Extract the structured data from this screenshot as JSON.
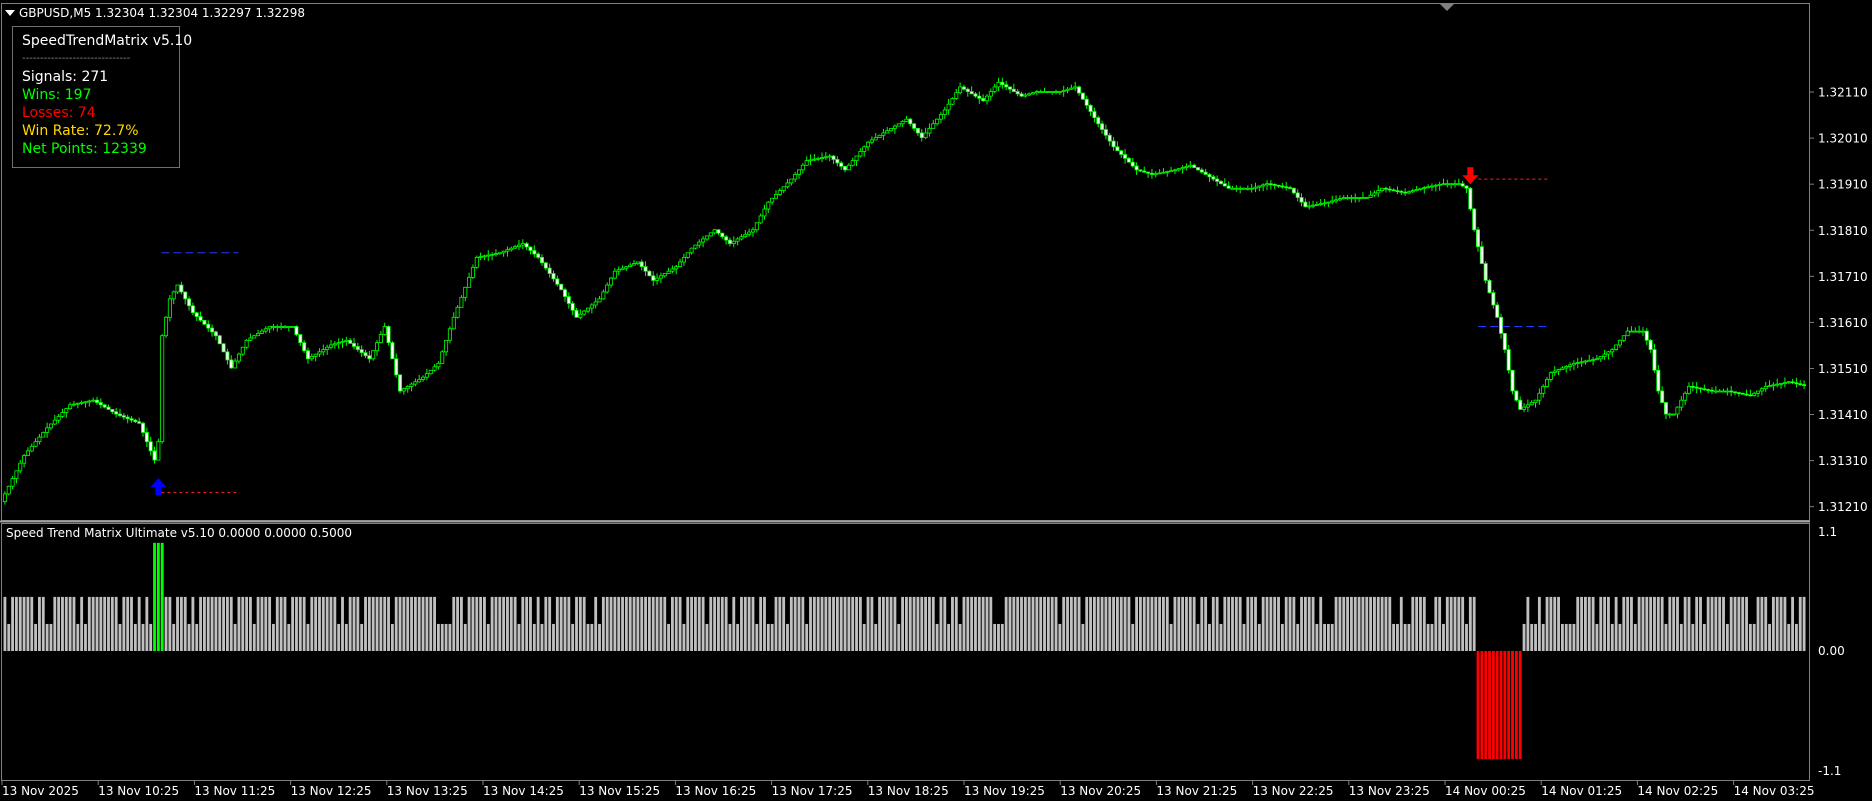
{
  "window": {
    "title": "GBPUSD,M5  1.32304 1.32304 1.32297 1.32298"
  },
  "stats_panel": {
    "title": "SpeedTrendMatrix v5.10",
    "separator": "------------------------------",
    "signals": "Signals: 271",
    "wins": "Wins: 197",
    "losses": "Losses: 74",
    "win_rate": "Win Rate: 72.7%",
    "net_points": "Net Points: 12339",
    "colors": {
      "text": "#ffffff",
      "wins": "#00ff00",
      "losses": "#ff0000",
      "win_rate": "#ffd700",
      "net_points": "#00ff00"
    }
  },
  "indicator_panel": {
    "title": "Speed Trend Matrix Ultimate v5.10 0.0000 0.0000 0.5000",
    "y_ticks": [
      "1.1",
      "0.00",
      "-1.1"
    ],
    "colors": {
      "neutral": "#c0c0c0",
      "bull": "#00ff00",
      "bear": "#ff0000"
    }
  },
  "price_axis": {
    "ticks": [
      "1.32110",
      "1.32010",
      "1.31910",
      "1.31810",
      "1.31710",
      "1.31610",
      "1.31510",
      "1.31410",
      "1.31310",
      "1.31210"
    ]
  },
  "time_axis": {
    "ticks": [
      "13 Nov 2025",
      "13 Nov 10:25",
      "13 Nov 11:25",
      "13 Nov 12:25",
      "13 Nov 13:25",
      "13 Nov 14:25",
      "13 Nov 15:25",
      "13 Nov 16:25",
      "13 Nov 17:25",
      "13 Nov 18:25",
      "13 Nov 19:25",
      "13 Nov 20:25",
      "13 Nov 21:25",
      "13 Nov 22:25",
      "13 Nov 23:25",
      "14 Nov 00:25",
      "14 Nov 01:25",
      "14 Nov 02:25",
      "14 Nov 03:25"
    ]
  },
  "chart_data": {
    "type": "candlestick",
    "symbol": "GBPUSD",
    "timeframe": "M5",
    "ylim": [
      1.3118,
      1.323
    ],
    "candle_color": "#00ff00",
    "candle_body_color": "#ffffff",
    "path": [
      [
        0,
        1.3122
      ],
      [
        6,
        1.3132
      ],
      [
        12,
        1.3138
      ],
      [
        18,
        1.3143
      ],
      [
        24,
        1.3144
      ],
      [
        30,
        1.3141
      ],
      [
        36,
        1.3139
      ],
      [
        40,
        1.3131
      ],
      [
        41,
        1.3135
      ],
      [
        42,
        1.3158
      ],
      [
        44,
        1.3166
      ],
      [
        46,
        1.3169
      ],
      [
        50,
        1.3163
      ],
      [
        56,
        1.3158
      ],
      [
        60,
        1.3151
      ],
      [
        64,
        1.3157
      ],
      [
        70,
        1.316
      ],
      [
        76,
        1.316
      ],
      [
        80,
        1.3153
      ],
      [
        86,
        1.3156
      ],
      [
        90,
        1.3157
      ],
      [
        96,
        1.3153
      ],
      [
        100,
        1.316
      ],
      [
        104,
        1.3146
      ],
      [
        110,
        1.3149
      ],
      [
        114,
        1.3152
      ],
      [
        118,
        1.3162
      ],
      [
        124,
        1.3175
      ],
      [
        130,
        1.3176
      ],
      [
        136,
        1.3178
      ],
      [
        140,
        1.3175
      ],
      [
        146,
        1.3168
      ],
      [
        150,
        1.3162
      ],
      [
        156,
        1.3166
      ],
      [
        160,
        1.3172
      ],
      [
        166,
        1.3174
      ],
      [
        170,
        1.317
      ],
      [
        176,
        1.3173
      ],
      [
        180,
        1.3177
      ],
      [
        186,
        1.3181
      ],
      [
        190,
        1.3178
      ],
      [
        196,
        1.3181
      ],
      [
        200,
        1.3187
      ],
      [
        206,
        1.3192
      ],
      [
        210,
        1.3196
      ],
      [
        216,
        1.3197
      ],
      [
        220,
        1.3194
      ],
      [
        226,
        1.32
      ],
      [
        230,
        1.3202
      ],
      [
        236,
        1.3205
      ],
      [
        240,
        1.3201
      ],
      [
        246,
        1.3207
      ],
      [
        250,
        1.3212
      ],
      [
        256,
        1.3209
      ],
      [
        260,
        1.3213
      ],
      [
        266,
        1.321
      ],
      [
        270,
        1.3211
      ],
      [
        276,
        1.3211
      ],
      [
        280,
        1.3212
      ],
      [
        286,
        1.3204
      ],
      [
        290,
        1.3199
      ],
      [
        296,
        1.3194
      ],
      [
        300,
        1.3193
      ],
      [
        306,
        1.3194
      ],
      [
        310,
        1.3195
      ],
      [
        316,
        1.3192
      ],
      [
        320,
        1.319
      ],
      [
        326,
        1.319
      ],
      [
        330,
        1.3191
      ],
      [
        336,
        1.319
      ],
      [
        340,
        1.3186
      ],
      [
        346,
        1.3187
      ],
      [
        350,
        1.3188
      ],
      [
        356,
        1.3188
      ],
      [
        360,
        1.319
      ],
      [
        366,
        1.3189
      ],
      [
        370,
        1.319
      ],
      [
        376,
        1.3191
      ],
      [
        380,
        1.3191
      ],
      [
        382,
        1.319
      ],
      [
        384,
        1.3181
      ],
      [
        387,
        1.317
      ],
      [
        390,
        1.3162
      ],
      [
        392,
        1.3155
      ],
      [
        394,
        1.3146
      ],
      [
        396,
        1.3142
      ],
      [
        400,
        1.3144
      ],
      [
        404,
        1.315
      ],
      [
        410,
        1.3152
      ],
      [
        416,
        1.3153
      ],
      [
        420,
        1.3155
      ],
      [
        424,
        1.3159
      ],
      [
        428,
        1.3159
      ],
      [
        430,
        1.3155
      ],
      [
        432,
        1.3146
      ],
      [
        434,
        1.3141
      ],
      [
        436,
        1.3141
      ],
      [
        440,
        1.3147
      ],
      [
        446,
        1.3146
      ],
      [
        450,
        1.3146
      ],
      [
        456,
        1.3145
      ],
      [
        460,
        1.3147
      ],
      [
        466,
        1.3148
      ],
      [
        471,
        1.3147
      ]
    ],
    "signals": [
      {
        "type": "buy",
        "bar": 40,
        "color": "#0000ff",
        "level": 1.3176,
        "sl": 1.3124
      },
      {
        "type": "sell",
        "bar": 382,
        "color": "#ff0000",
        "level": 1.316,
        "sl": 1.3192
      }
    ],
    "indicator_bars": {
      "total": 470,
      "bull_range": [
        39,
        42
      ],
      "bear_range": [
        384,
        396
      ],
      "full_height": 0.5,
      "half_height": 0.25
    }
  }
}
